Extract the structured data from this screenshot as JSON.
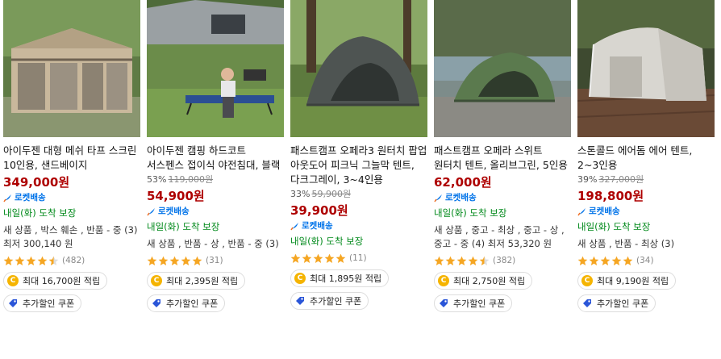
{
  "products": [
    {
      "image": "tan-mesh-screen-tent-photo",
      "title": "아이두젠 대형 메쉬 타프 스크린 10인용, 샌드베이지",
      "discount_rate": "",
      "original_price": "",
      "price": "349,000원",
      "rocket": "로켓배송",
      "arrival": "내일(화) 도착 보장",
      "other_sellers": "새 상품 , 박스 훼손 , 반품 - 중 (3) 최저 300,140 원",
      "rating": 4.5,
      "review_count": "(482)",
      "points": "최대 16,700원 적립",
      "coupon": "추가할인 쿠폰"
    },
    {
      "image": "camping-cot-with-man-photo",
      "title": "아이두젠 캠핑 하드코트 서스펜스 접이식 야전침대, 블랙",
      "discount_rate": "53%",
      "original_price": "119,000원",
      "price": "54,900원",
      "rocket": "로켓배송",
      "arrival": "내일(화) 도착 보장",
      "other_sellers": "새 상품 , 반품 - 상 , 반품 - 중 (3)",
      "rating": 5,
      "review_count": "(31)",
      "points": "최대 2,395원 적립",
      "coupon": "추가할인 쿠폰"
    },
    {
      "image": "dark-grey-popup-tent-photo",
      "title": "패스트캠프 오페라3 원터치 팝업 아웃도어 피크닉 그늘막 텐트, 다크그레이, 3~4인용",
      "discount_rate": "33%",
      "original_price": "59,900원",
      "price": "39,900원",
      "rocket": "로켓배송",
      "arrival": "내일(화) 도착 보장",
      "other_sellers": "",
      "rating": 5,
      "review_count": "(11)",
      "points": "최대 1,895원 적립",
      "coupon": "추가할인 쿠폰"
    },
    {
      "image": "olive-green-popup-tent-photo",
      "title": "패스트캠프 오페라 스위트 원터치 텐트, 올리브그린, 5인용",
      "discount_rate": "",
      "original_price": "",
      "price": "62,000원",
      "rocket": "로켓배송",
      "arrival": "내일(화) 도착 보장",
      "other_sellers": "새 상품 , 중고 - 최상 , 중고 - 상 , 중고 - 중 (4) 최저 53,320 원",
      "rating": 4.5,
      "review_count": "(382)",
      "points": "최대 2,750원 적립",
      "coupon": "추가할인 쿠폰"
    },
    {
      "image": "white-air-dome-tent-photo",
      "title": "스톤콜드 에어돔 에어 텐트, 2~3인용",
      "discount_rate": "39%",
      "original_price": "327,000원",
      "price": "198,800원",
      "rocket": "로켓배송",
      "arrival": "내일(화) 도착 보장",
      "other_sellers": "새 상품 , 반품 - 최상 (3)",
      "rating": 5,
      "review_count": "(34)",
      "points": "최대 9,190원 적립",
      "coupon": "추가할인 쿠폰"
    }
  ],
  "colors": {
    "price": "#ae0000",
    "rocket": "#0073e9",
    "arrival": "#00891a",
    "star": "#f5a623",
    "coin": "#f5b400"
  },
  "icons": {
    "rocket": "rocket-icon",
    "star": "star-icon",
    "coin": "coin-icon",
    "coupon": "coupon-tag-icon"
  }
}
